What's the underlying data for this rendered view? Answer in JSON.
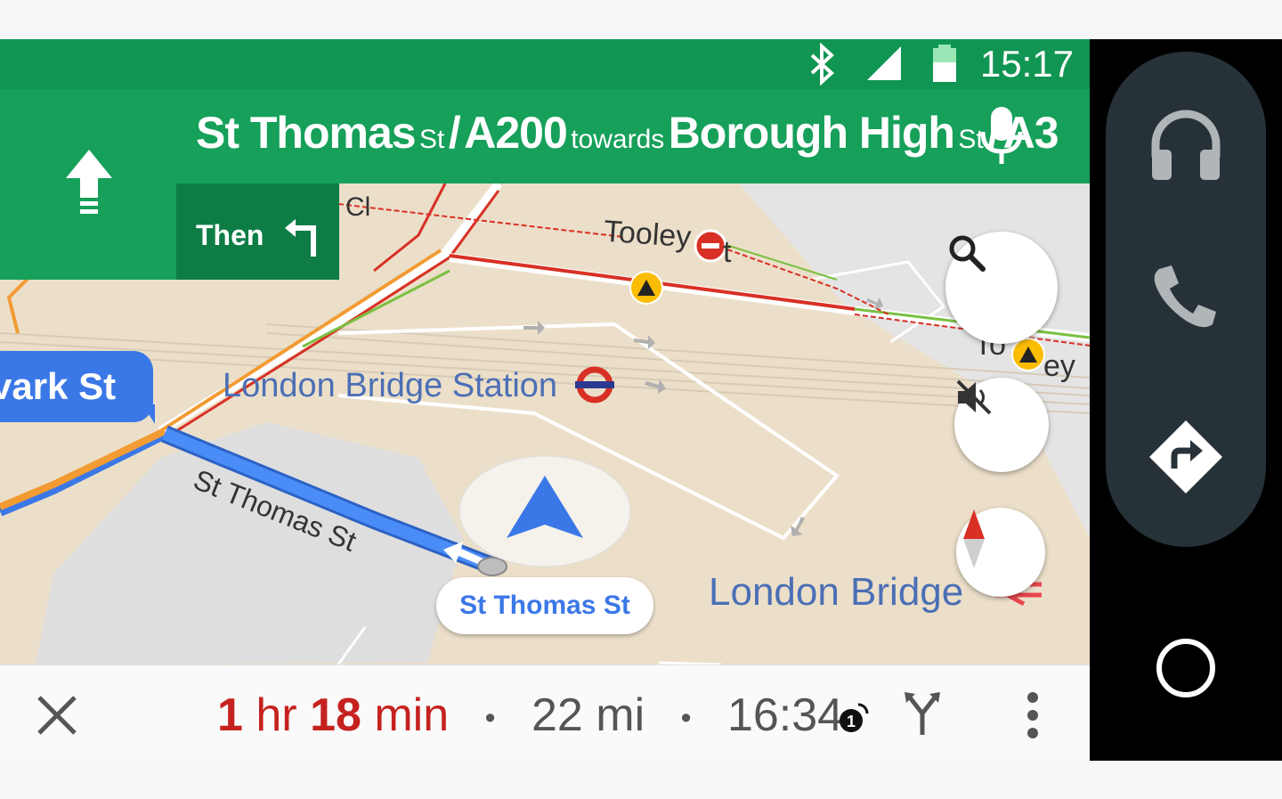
{
  "status_bar": {
    "time": "15:17"
  },
  "direction": {
    "road1": "St Thomas",
    "road1_suffix": "St",
    "sep1": "/",
    "road2": "A200",
    "towards": "towards",
    "road3": "Borough High",
    "road3_suffix": "St",
    "sep2": "/",
    "road4": "A3"
  },
  "then_label": "Then",
  "map": {
    "current_street_tag": "vark St",
    "current_road_pill": "St Thomas St",
    "labels": {
      "london_bridge_station": "London Bridge Station",
      "london_bridge": "London Bridge",
      "st_thomas_st_route": "St Thomas St",
      "tooley_top": "Tooley",
      "tooley_t": "t",
      "tooley_right": "To",
      "tooley_right_end": "ey",
      "cl": "Cl"
    }
  },
  "eta_bar": {
    "duration_num1": "1",
    "duration_unit1": " hr ",
    "duration_num2": "18",
    "duration_unit2": " min",
    "distance": "22 mi",
    "arrival": "16:34",
    "separator": "•"
  },
  "colors": {
    "accent_green": "#16a05a",
    "route_blue": "#3b78e7",
    "traffic_red": "#c5221f"
  }
}
